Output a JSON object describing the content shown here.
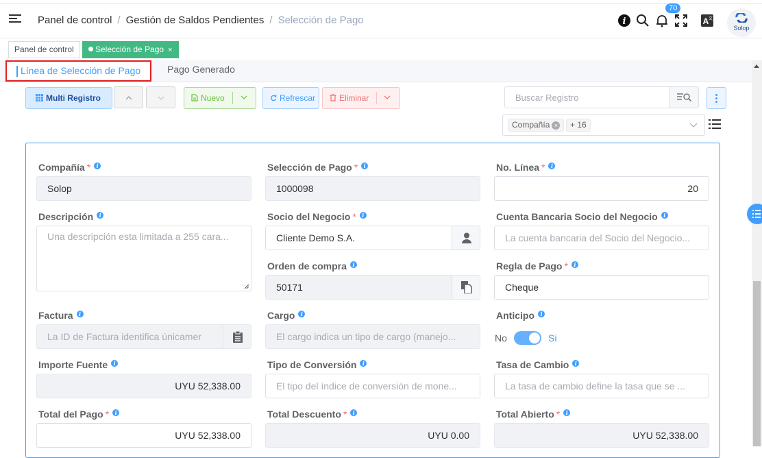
{
  "breadcrumb": [
    "Panel de control",
    "Gestión de Saldos Pendientes",
    "Selección de Pago"
  ],
  "header": {
    "notifications_count": "70",
    "logo_text": "Solop"
  },
  "tags": [
    {
      "label": "Panel de control"
    },
    {
      "label": "Selección de Pago",
      "close": "×"
    }
  ],
  "subtabs": [
    "Línea de Selección de Pago",
    "Pago Generado"
  ],
  "toolbar": {
    "multi": "Multi Registro",
    "new": "Nuevo",
    "refresh": "Refrescar",
    "delete": "Eliminar",
    "search_placeholder": "Buscar Registro",
    "column_chip": "Compañía",
    "column_more": "+ 16"
  },
  "form": {
    "company": {
      "label": "Compañía",
      "value": "Solop"
    },
    "payment_selection": {
      "label": "Selección de Pago",
      "value": "1000098"
    },
    "line_no": {
      "label": "No. Línea",
      "value": "20"
    },
    "description": {
      "label": "Descripción",
      "placeholder": "Una descripción esta limitada a 255 cara..."
    },
    "business_partner": {
      "label": "Socio del Negocio",
      "value": "Cliente Demo S.A."
    },
    "bp_bank_account": {
      "label": "Cuenta Bancaria Socio del Negocio",
      "placeholder": "La cuenta bancaria del Socio del Negocio..."
    },
    "purchase_order": {
      "label": "Orden de compra",
      "value": "50171"
    },
    "payment_rule": {
      "label": "Regla de Pago",
      "value": "Cheque"
    },
    "invoice": {
      "label": "Factura",
      "placeholder": "La ID de Factura identifica únicamer"
    },
    "charge": {
      "label": "Cargo",
      "placeholder": "El cargo indica un tipo de cargo (manejo..."
    },
    "prepayment": {
      "label": "Anticipo",
      "off": "No",
      "on": "Si"
    },
    "source_amount": {
      "label": "Importe Fuente",
      "value": "UYU 52,338.00"
    },
    "conversion_type": {
      "label": "Tipo de Conversión",
      "placeholder": "El tipo del índice de conversión de mone..."
    },
    "exchange_rate": {
      "label": "Tasa de Cambio",
      "placeholder": "La tasa de cambio define la tasa que se ..."
    },
    "pay_amount": {
      "label": "Total del Pago",
      "value": "UYU 52,338.00"
    },
    "discount_amount": {
      "label": "Total Descuento",
      "value": "UYU 0.00"
    },
    "open_amount": {
      "label": "Total Abierto",
      "value": "UYU 52,338.00"
    }
  },
  "colors": {
    "accent": "#409eff",
    "tag_active": "#42b983",
    "required": "#f56c6c",
    "highlight_border": "#e0201f"
  }
}
